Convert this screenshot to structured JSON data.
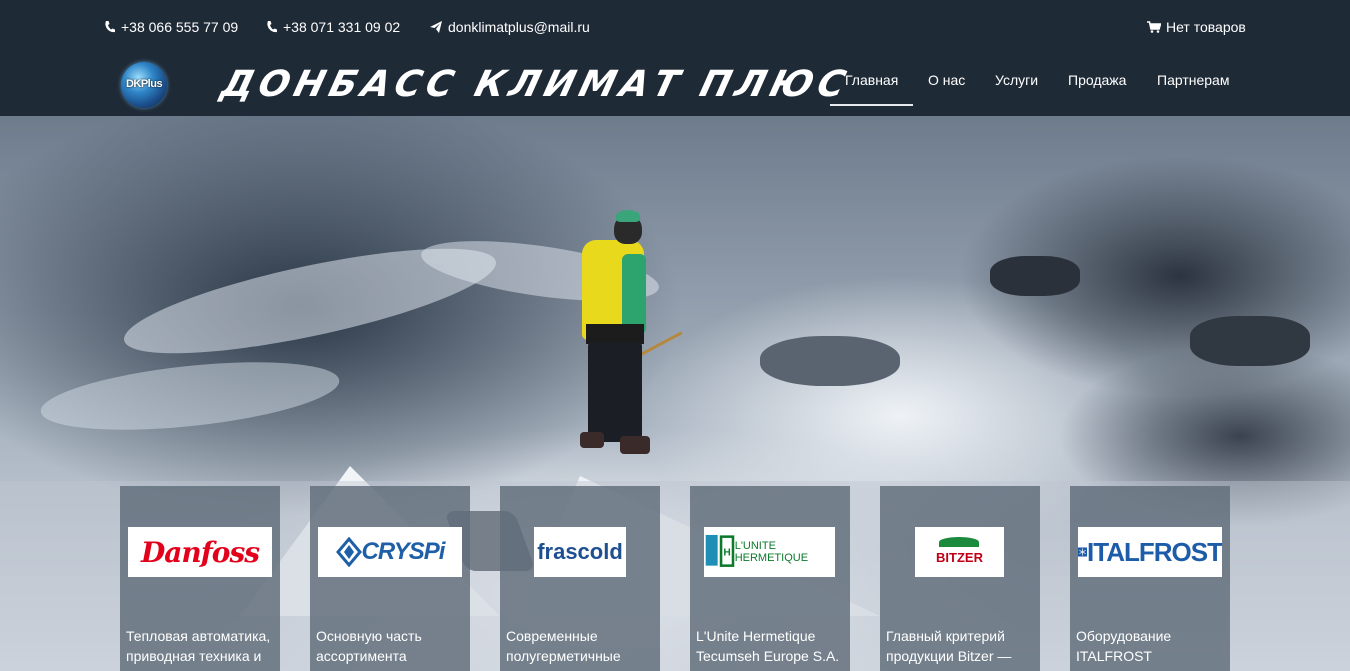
{
  "topbar": {
    "phone1": "+38 066 555 77 09",
    "phone2": "+38 071 331 09 02",
    "email": "donklimatplus@mail.ru",
    "cart": "Нет товаров"
  },
  "header": {
    "logo_text": "DKPlus",
    "brand": "ДОНБАСС КЛИМАТ ПЛЮС"
  },
  "menu": [
    {
      "label": "Главная",
      "active": true
    },
    {
      "label": "О нас"
    },
    {
      "label": "Услуги"
    },
    {
      "label": "Продажа"
    },
    {
      "label": "Партнерам"
    }
  ],
  "brands": [
    {
      "logo": "Danfoss",
      "text": "Тепловая автоматика, приводная техника и"
    },
    {
      "logo": "CRYSPi",
      "text": "Основную часть ассортимента"
    },
    {
      "logo": "frascold",
      "text": "Современные полугерметичные"
    },
    {
      "logo": "L'UNITE HERMETIQUE",
      "text": "L'Unite Hermetique Tecumseh Europe S.A."
    },
    {
      "logo": "BITZER",
      "text": "Главный критерий продукции Bitzer —"
    },
    {
      "logo": "ITALFROST",
      "text": "Оборудование ITALFROST"
    }
  ],
  "colors": {
    "header_bg": "#1f2a37",
    "card_bg": "#606c7a"
  },
  "icons": [
    "phone-icon",
    "phone-icon",
    "paper-plane-icon",
    "cart-icon"
  ]
}
